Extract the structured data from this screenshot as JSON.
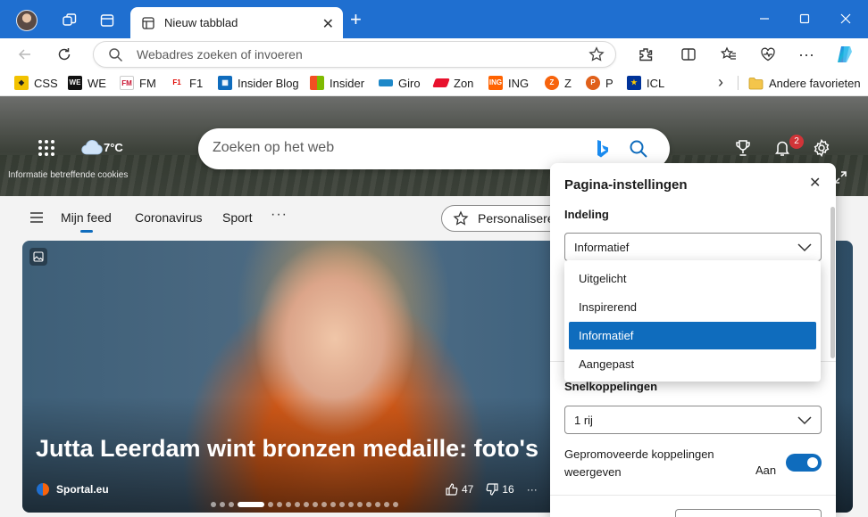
{
  "browser": {
    "tab_title": "Nieuw tabblad",
    "address_placeholder": "Webadres zoeken of invoeren",
    "favorites": [
      {
        "label": "CSS",
        "color": "#f2c200",
        "glyph": "◆"
      },
      {
        "label": "WE",
        "color": "#111111",
        "glyph": "WE"
      },
      {
        "label": "FM",
        "color": "#c8102e",
        "glyph": "FM"
      },
      {
        "label": "F1",
        "color": "#e10600",
        "glyph": "F1"
      },
      {
        "label": "Insider Blog",
        "color": "#0f6cbd",
        "glyph": "▦"
      },
      {
        "label": "Insider",
        "color": "#f25022",
        "glyph": "▦"
      },
      {
        "label": "Giro",
        "color": "#1e88c8",
        "glyph": "▬"
      },
      {
        "label": "Zon",
        "color": "#e8112d",
        "glyph": "▰"
      },
      {
        "label": "ING",
        "color": "#ff6200",
        "glyph": "ING"
      },
      {
        "label": "Z",
        "color": "#f7630c",
        "glyph": "Z"
      },
      {
        "label": "P",
        "color": "#e0601a",
        "glyph": "P"
      },
      {
        "label": "ICL",
        "color": "#003399",
        "glyph": "★"
      }
    ],
    "other_favorites": "Andere favorieten"
  },
  "newtab": {
    "weather_temp": "7°C",
    "cookie_info": "Informatie betreffende cookies",
    "search_placeholder": "Zoeken op het web",
    "notification_count": "2",
    "feed_tabs": [
      "Mijn feed",
      "Coronavirus",
      "Sport"
    ],
    "feed_more": "···",
    "personalize_label": "Personaliseren"
  },
  "card": {
    "headline": "Jutta Leerdam wint bronzen medaille: foto's",
    "source": "Sportal.eu",
    "likes": "47",
    "dislikes": "16",
    "more": "···",
    "slide_count": 19,
    "active_slide": 3
  },
  "settings_panel": {
    "title": "Pagina-instellingen",
    "layout_label": "Indeling",
    "layout_value": "Informatief",
    "layout_options": [
      "Uitgelicht",
      "Inspirerend",
      "Informatief",
      "Aangepast"
    ],
    "layout_selected_index": 2,
    "quicklinks_label": "Snelkoppelingen",
    "quicklinks_value": "1 rij",
    "promoted_label": "Gepromoveerde koppelingen weergeven",
    "promoted_state": "Aan",
    "promoted_on": true
  },
  "colors": {
    "accent": "#0f6cbd",
    "titlebar": "#1f6fd0",
    "badge": "#d13438"
  }
}
